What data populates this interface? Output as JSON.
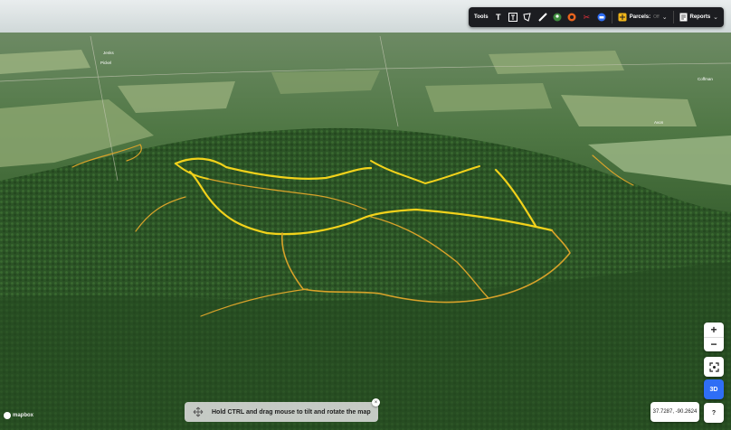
{
  "toolbar": {
    "tools_label": "Tools",
    "icons": [
      "text-icon",
      "text-box-icon",
      "polygon-icon",
      "ruler-icon",
      "globe-pin-icon",
      "target-icon",
      "scissors-icon",
      "car-icon"
    ],
    "parcels_label": "Parcels:",
    "parcels_state": "Off",
    "reports_label": "Reports"
  },
  "controls": {
    "zoom_in": "+",
    "zoom_out": "−",
    "three_d": "3D",
    "help": "?"
  },
  "coordinates": "37.7287, -90.2624",
  "hint": "Hold CTRL and drag mouse to tilt and rotate the map",
  "hint_close": "×",
  "attribution": "mapbox",
  "places": [
    "Jenks",
    "Pickel",
    "Coffman",
    "Avon"
  ],
  "colors": {
    "trail": "#f2d21b",
    "trail_minor": "#d8a22a",
    "accent": "#2f6ef5"
  }
}
